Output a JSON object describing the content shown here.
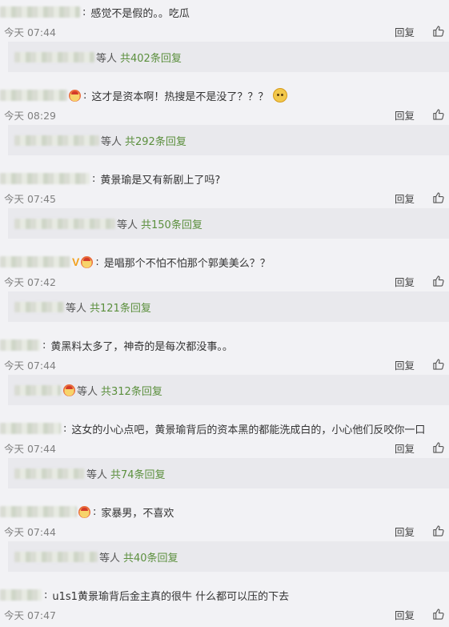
{
  "reply_label": "回复",
  "others_label": "等人",
  "comments": [
    {
      "text": "感觉不是假的。。吃瓜",
      "time": "今天 07:44",
      "name_width": 100,
      "badges": [],
      "suffix_emoji": false,
      "replies": {
        "count_text": "共402条回复",
        "name_width": 100,
        "emoji": false
      }
    },
    {
      "text": "这才是资本啊！热搜是不是没了？？？",
      "time": "今天 08:29",
      "name_width": 84,
      "badges": [
        "emoji"
      ],
      "suffix_emoji": true,
      "replies": {
        "count_text": "共292条回复",
        "name_width": 106,
        "emoji": false
      }
    },
    {
      "text": "黄景瑜是又有新剧上了吗?",
      "time": "今天 07:45",
      "name_width": 112,
      "badges": [],
      "suffix_emoji": false,
      "replies": {
        "count_text": "共150条回复",
        "name_width": 126,
        "emoji": false
      }
    },
    {
      "text": "是唱那个不怕不怕那个郭美美么？？",
      "time": "今天 07:42",
      "name_width": 88,
      "badges": [
        "V",
        "emoji"
      ],
      "suffix_emoji": false,
      "replies": {
        "count_text": "共121条回复",
        "name_width": 62,
        "emoji": false
      }
    },
    {
      "text": "黄黑料太多了，神奇的是每次都没事。。",
      "time": "今天 07:44",
      "name_width": 50,
      "badges": [],
      "suffix_emoji": false,
      "replies": {
        "count_text": "共312条回复",
        "name_width": 58,
        "emoji": true
      }
    },
    {
      "text": "这女的小心点吧，黄景瑜背后的资本黑的都能洗成白的，小心他们反咬你一口",
      "time": "今天 07:44",
      "name_width": 76,
      "badges": [],
      "suffix_emoji": false,
      "replies": {
        "count_text": "共74条回复",
        "name_width": 88,
        "emoji": false
      }
    },
    {
      "text": "家暴男，不喜欢",
      "time": "今天 07:44",
      "name_width": 96,
      "badges": [
        "emoji"
      ],
      "suffix_emoji": false,
      "replies": {
        "count_text": "共40条回复",
        "name_width": 104,
        "emoji": false
      }
    },
    {
      "text": "u1s1黄景瑜背后金主真的很牛 什么都可以压的下去",
      "time": "今天 07:47",
      "name_width": 52,
      "badges": [],
      "suffix_emoji": false,
      "replies": null
    }
  ]
}
